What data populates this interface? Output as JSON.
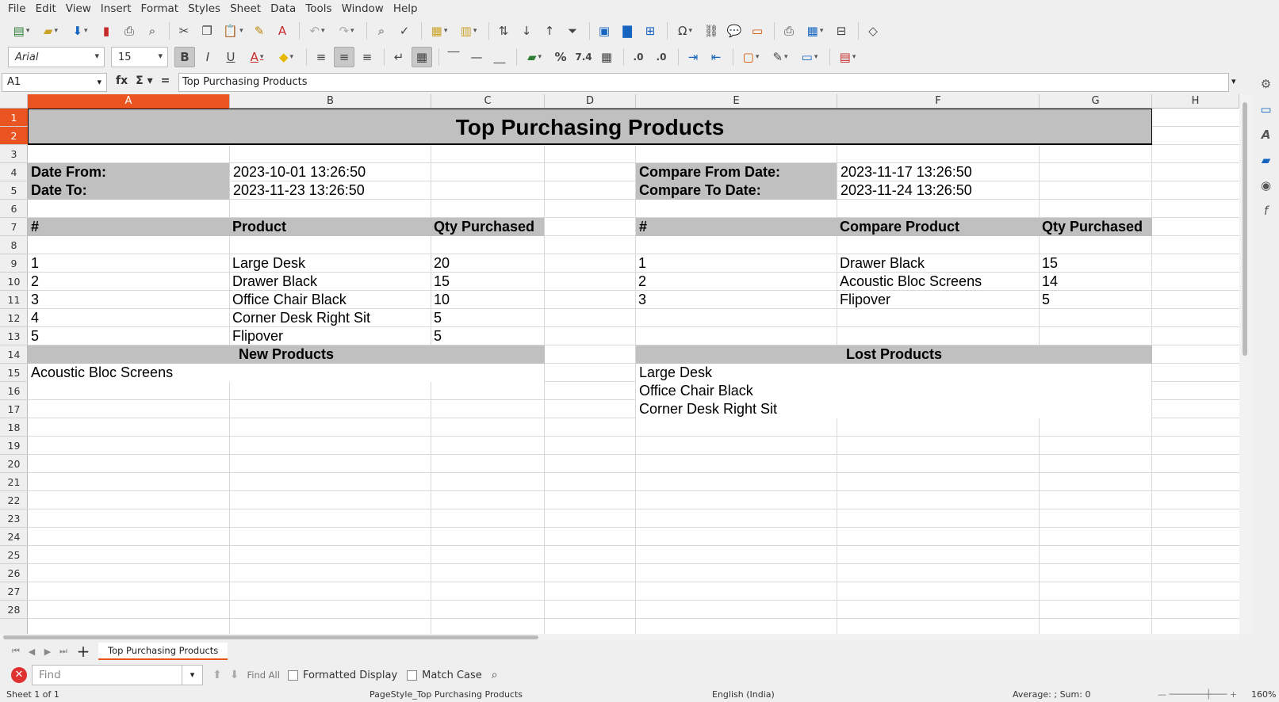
{
  "menu": [
    "File",
    "Edit",
    "View",
    "Insert",
    "Format",
    "Styles",
    "Sheet",
    "Data",
    "Tools",
    "Window",
    "Help"
  ],
  "font": {
    "name": "Arial",
    "size": "15"
  },
  "formula_bar": {
    "cell_ref": "A1",
    "content": "Top Purchasing Products"
  },
  "columns": [
    "A",
    "B",
    "C",
    "D",
    "E",
    "F",
    "G",
    "H"
  ],
  "rows": [
    "1",
    "2",
    "3",
    "4",
    "5",
    "6",
    "7",
    "8",
    "9",
    "10",
    "11",
    "12",
    "13",
    "14",
    "15",
    "16",
    "17",
    "18",
    "19",
    "20",
    "21",
    "22",
    "23",
    "24",
    "25",
    "26",
    "27",
    "28"
  ],
  "sheet": {
    "title": "Top Purchasing Products",
    "date_from_label": "Date From:",
    "date_from_value": "2023-10-01 13:26:50",
    "date_to_label": "Date To:",
    "date_to_value": "2023-11-23 13:26:50",
    "compare_from_label": "Compare From Date:",
    "compare_from_value": "2023-11-17 13:26:50",
    "compare_to_label": "Compare To Date:",
    "compare_to_value": "2023-11-24 13:26:50",
    "left_headers": [
      "#",
      "Product",
      "Qty Purchased"
    ],
    "right_headers": [
      "#",
      "Compare Product",
      "Qty Purchased"
    ],
    "left_rows": [
      [
        "1",
        "Large Desk",
        "20"
      ],
      [
        "2",
        "Drawer Black",
        "15"
      ],
      [
        "3",
        "Office Chair Black",
        "10"
      ],
      [
        "4",
        "Corner Desk Right Sit",
        "5"
      ],
      [
        "5",
        "Flipover",
        "5"
      ]
    ],
    "right_rows": [
      [
        "1",
        "Drawer Black",
        "15"
      ],
      [
        "2",
        "Acoustic Bloc Screens",
        "14"
      ],
      [
        "3",
        "Flipover",
        "5"
      ]
    ],
    "new_products_label": "New Products",
    "new_products": [
      "Acoustic Bloc Screens"
    ],
    "lost_products_label": "Lost Products",
    "lost_products": [
      "Large Desk",
      "Office Chair Black",
      "Corner Desk Right Sit"
    ]
  },
  "tab_name": "Top Purchasing Products",
  "find": {
    "placeholder": "Find",
    "find_all": "Find All",
    "formatted_display": "Formatted Display",
    "match_case": "Match Case"
  },
  "status": {
    "sheet": "Sheet 1 of 1",
    "page_style": "PageStyle_Top Purchasing Products",
    "language": "English (India)",
    "summary": "Average: ; Sum: 0",
    "zoom": "160%"
  }
}
